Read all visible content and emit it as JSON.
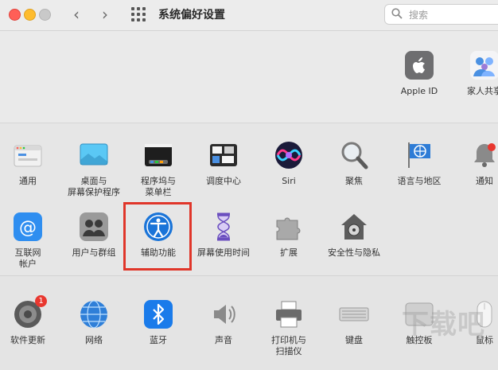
{
  "window": {
    "title": "系统偏好设置"
  },
  "toolbar": {
    "back_icon": "chevron-left-icon",
    "forward_icon": "chevron-right-icon",
    "grid_icon": "grid-icon"
  },
  "search": {
    "placeholder": "搜索"
  },
  "top_section": {
    "items": [
      {
        "label": "Apple ID",
        "icon": "apple-logo-icon"
      },
      {
        "label": "家人共享",
        "icon": "family-sharing-icon"
      }
    ]
  },
  "main_section": {
    "row1": [
      {
        "label": "通用",
        "icon": "general-icon"
      },
      {
        "label": "桌面与\n屏幕保护程序",
        "icon": "desktop-screensaver-icon"
      },
      {
        "label": "程序坞与\n菜单栏",
        "icon": "dock-menubar-icon"
      },
      {
        "label": "调度中心",
        "icon": "mission-control-icon"
      },
      {
        "label": "Siri",
        "icon": "siri-icon"
      },
      {
        "label": "聚焦",
        "icon": "spotlight-icon"
      },
      {
        "label": "语言与地区",
        "icon": "language-region-icon"
      },
      {
        "label": "通知",
        "icon": "notifications-icon"
      }
    ],
    "row2": [
      {
        "label": "互联网\n帐户",
        "icon": "internet-accounts-icon"
      },
      {
        "label": "用户与群组",
        "icon": "users-groups-icon"
      },
      {
        "label": "辅助功能",
        "icon": "accessibility-icon"
      },
      {
        "label": "屏幕使用时间",
        "icon": "screen-time-icon"
      },
      {
        "label": "扩展",
        "icon": "extensions-icon"
      },
      {
        "label": "安全性与隐私",
        "icon": "security-privacy-icon"
      }
    ]
  },
  "hardware_section": {
    "items": [
      {
        "label": "软件更新",
        "icon": "software-update-icon",
        "badge": "1"
      },
      {
        "label": "网络",
        "icon": "network-icon"
      },
      {
        "label": "蓝牙",
        "icon": "bluetooth-icon"
      },
      {
        "label": "声音",
        "icon": "sound-icon"
      },
      {
        "label": "打印机与\n扫描仪",
        "icon": "printers-scanners-icon"
      },
      {
        "label": "键盘",
        "icon": "keyboard-icon"
      },
      {
        "label": "触控板",
        "icon": "trackpad-icon"
      },
      {
        "label": "鼠标",
        "icon": "mouse-icon"
      }
    ]
  },
  "watermark": {
    "text": "下载吧"
  },
  "colors": {
    "highlight": "#e0362a",
    "badge": "#e8372f",
    "accessibility_blue": "#1a74d8"
  }
}
